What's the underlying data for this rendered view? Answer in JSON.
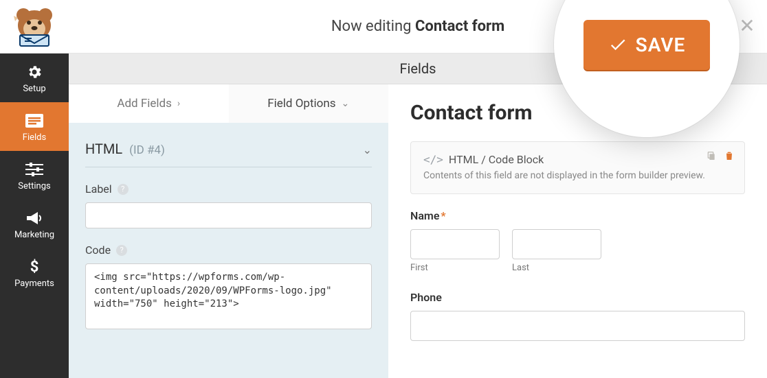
{
  "header": {
    "editing_prefix": "Now editing",
    "form_name": "Contact form",
    "embed_glyph": "</>",
    "save_label": "SAVE"
  },
  "sidebar": {
    "items": [
      {
        "label": "Setup"
      },
      {
        "label": "Fields"
      },
      {
        "label": "Settings"
      },
      {
        "label": "Marketing"
      },
      {
        "label": "Payments"
      }
    ],
    "active_index": 1
  },
  "section_title": "Fields",
  "left": {
    "tabs": {
      "add": "Add Fields",
      "options": "Field Options"
    },
    "options": {
      "heading": "HTML",
      "id_text": "(ID #4)",
      "label_caption": "Label",
      "label_value": "",
      "code_caption": "Code",
      "code_value": "<img src=\"https://wpforms.com/wp-content/uploads/2020/09/WPForms-logo.jpg\" width=\"750\" height=\"213\">"
    }
  },
  "preview": {
    "form_title": "Contact form",
    "html_block_title": "HTML / Code Block",
    "html_block_note": "Contents of this field are not displayed in the form builder preview.",
    "name": {
      "label": "Name",
      "first": "First",
      "last": "Last"
    },
    "phone_label": "Phone"
  }
}
